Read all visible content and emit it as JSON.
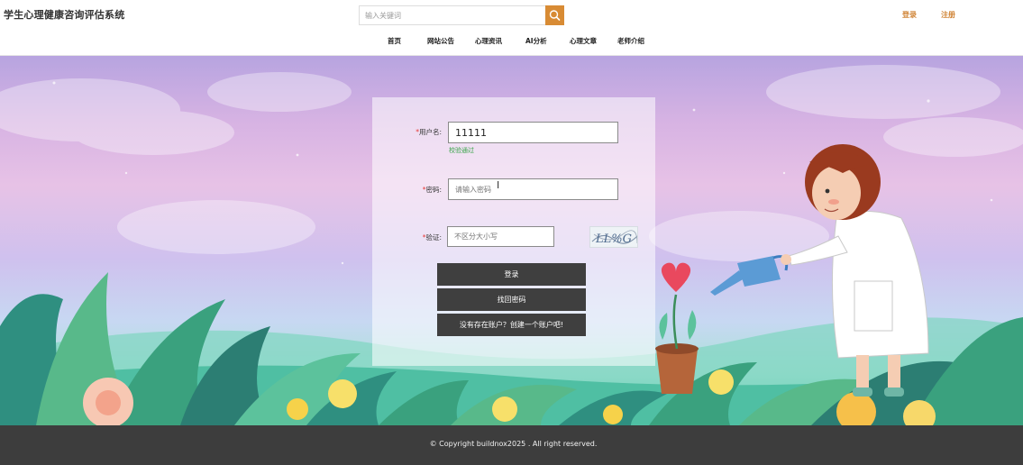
{
  "header": {
    "site_title": "学生心理健康咨询评估系统",
    "search_placeholder": "输入关键词",
    "login_link": "登录",
    "register_link": "注册"
  },
  "nav": {
    "items": [
      {
        "label": "首页"
      },
      {
        "label": "网站公告"
      },
      {
        "label": "心理资讯"
      },
      {
        "label": "AI分析"
      },
      {
        "label": "心理文章"
      },
      {
        "label": "老师介绍"
      }
    ]
  },
  "login_form": {
    "username": {
      "label": "用户名:",
      "value": "11111",
      "hint": "校验通过"
    },
    "password": {
      "label": "密码:",
      "placeholder": "请输入密码"
    },
    "captcha": {
      "label": "验证:",
      "placeholder": "不区分大小写",
      "image_text": "LL%G"
    },
    "buttons": {
      "login": "登录",
      "find_password": "找回密码",
      "register": "没有存在账户？创建一个账户吧!"
    }
  },
  "footer": {
    "copyright": "© Copyright buildnox2025 . All right reserved."
  },
  "colors": {
    "accent": "#d88b34",
    "button_dark": "#3f3f3f",
    "footer_bg": "#3d3d3d",
    "success": "#3aa54a",
    "required": "#e53935"
  }
}
